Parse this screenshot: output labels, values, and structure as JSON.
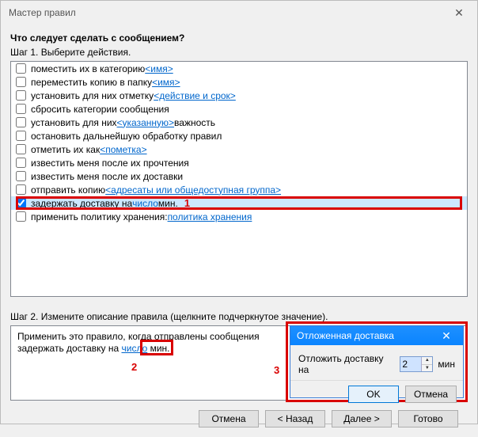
{
  "window": {
    "title": "Мастер правил",
    "close_glyph": "✕"
  },
  "step1": {
    "question": "Что следует сделать с сообщением?",
    "label": "Шаг 1. Выберите действия."
  },
  "actions": [
    {
      "pre": "поместить их в категорию ",
      "link": "<имя>",
      "post": ""
    },
    {
      "pre": "переместить копию в папку ",
      "link": "<имя>",
      "post": ""
    },
    {
      "pre": "установить для них отметку ",
      "link": "<действие и срок>",
      "post": ""
    },
    {
      "pre": "сбросить категории сообщения",
      "link": "",
      "post": ""
    },
    {
      "pre": "установить для них ",
      "link": "<указанную>",
      "post": " важность"
    },
    {
      "pre": "остановить дальнейшую обработку правил",
      "link": "",
      "post": ""
    },
    {
      "pre": "отметить их как ",
      "link": "<пометка>",
      "post": ""
    },
    {
      "pre": "известить меня после их прочтения",
      "link": "",
      "post": ""
    },
    {
      "pre": "известить меня после их доставки",
      "link": "",
      "post": ""
    },
    {
      "pre": "отправить копию ",
      "link": "<адресаты или общедоступная группа>",
      "post": ""
    },
    {
      "pre": "задержать доставку на ",
      "link": "число",
      "post": " мин.",
      "checked": true,
      "selected": true,
      "marker": "1"
    },
    {
      "pre": "применить политику хранения: ",
      "link": "политика хранения",
      "post": ""
    }
  ],
  "step2": {
    "label": "Шаг 2. Измените описание правила (щелкните подчеркнутое значение).",
    "line1": "Применить это правило, когда отправлены сообщения",
    "line2_pre": "задержать доставку на ",
    "line2_link": "число",
    "line2_post": " мин.",
    "marker2": "2",
    "marker3": "3"
  },
  "popup": {
    "title": "Отложенная доставка",
    "close_glyph": "✕",
    "label": "Отложить доставку на",
    "value": "2",
    "unit": "мин",
    "ok": "OK",
    "cancel": "Отмена"
  },
  "footer": {
    "cancel": "Отмена",
    "back": "<  Назад",
    "next": "Далее  >",
    "finish": "Готово"
  }
}
